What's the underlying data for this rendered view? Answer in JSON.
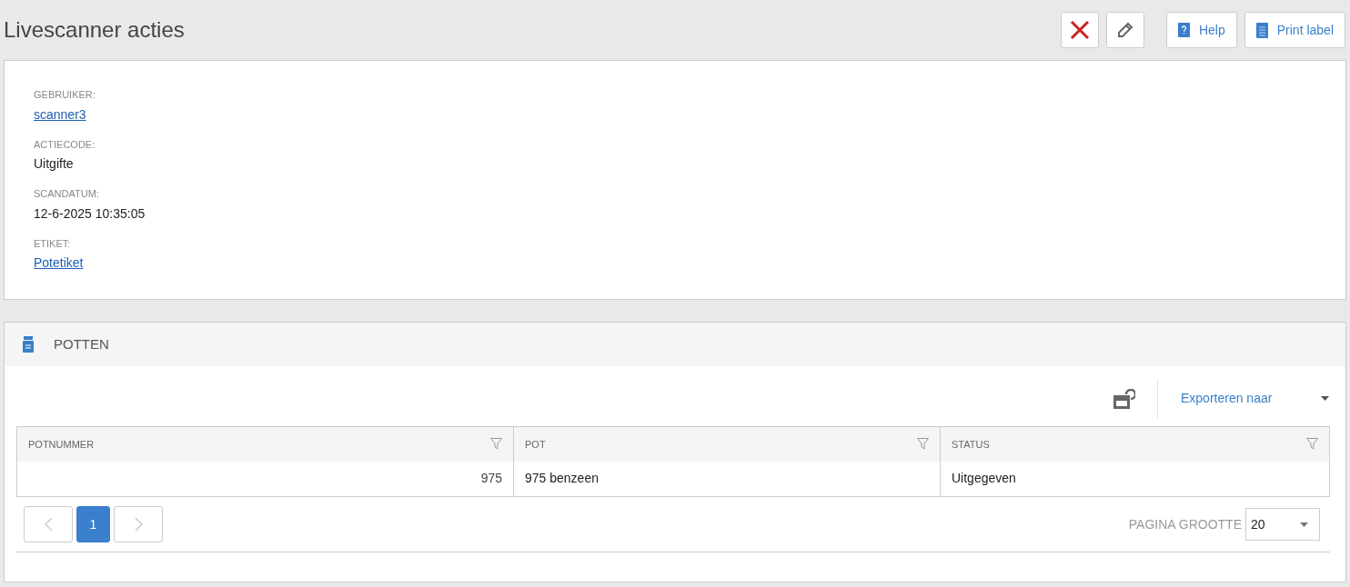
{
  "page": {
    "title": "Livescanner acties"
  },
  "toolbar": {
    "actions": [
      {
        "kind": "delete"
      },
      {
        "kind": "edit"
      }
    ],
    "buttons": [
      {
        "kind": "help",
        "label": "Help"
      },
      {
        "kind": "print",
        "label": "Print label"
      }
    ]
  },
  "details": [
    {
      "label": "GEBRUIKER:",
      "value": "scanner3",
      "kind": "link"
    },
    {
      "label": "ACTIECODE:",
      "value": "Uitgifte",
      "kind": "text"
    },
    {
      "label": "SCANDATUM:",
      "value": "12-6-2025 10:35:05",
      "kind": "text"
    },
    {
      "label": "ETIKET:",
      "value": "Potetiket",
      "kind": "link"
    }
  ],
  "panel": {
    "title": "POTTEN",
    "export_label": "Exporteren naar",
    "table": {
      "columns": [
        {
          "label": "POTNUMMER",
          "kind": "number"
        },
        {
          "label": "POT",
          "kind": "text"
        },
        {
          "label": "STATUS",
          "kind": "text"
        }
      ],
      "rows": [
        [
          "975",
          "975 benzeen",
          "Uitgegeven"
        ]
      ]
    },
    "pager": {
      "prev_disabled": true,
      "next_disabled": true,
      "pages": [
        {
          "label": "1",
          "selected": true
        }
      ],
      "page_size_label": "PAGINA GROOTTE",
      "page_size": "20"
    }
  }
}
